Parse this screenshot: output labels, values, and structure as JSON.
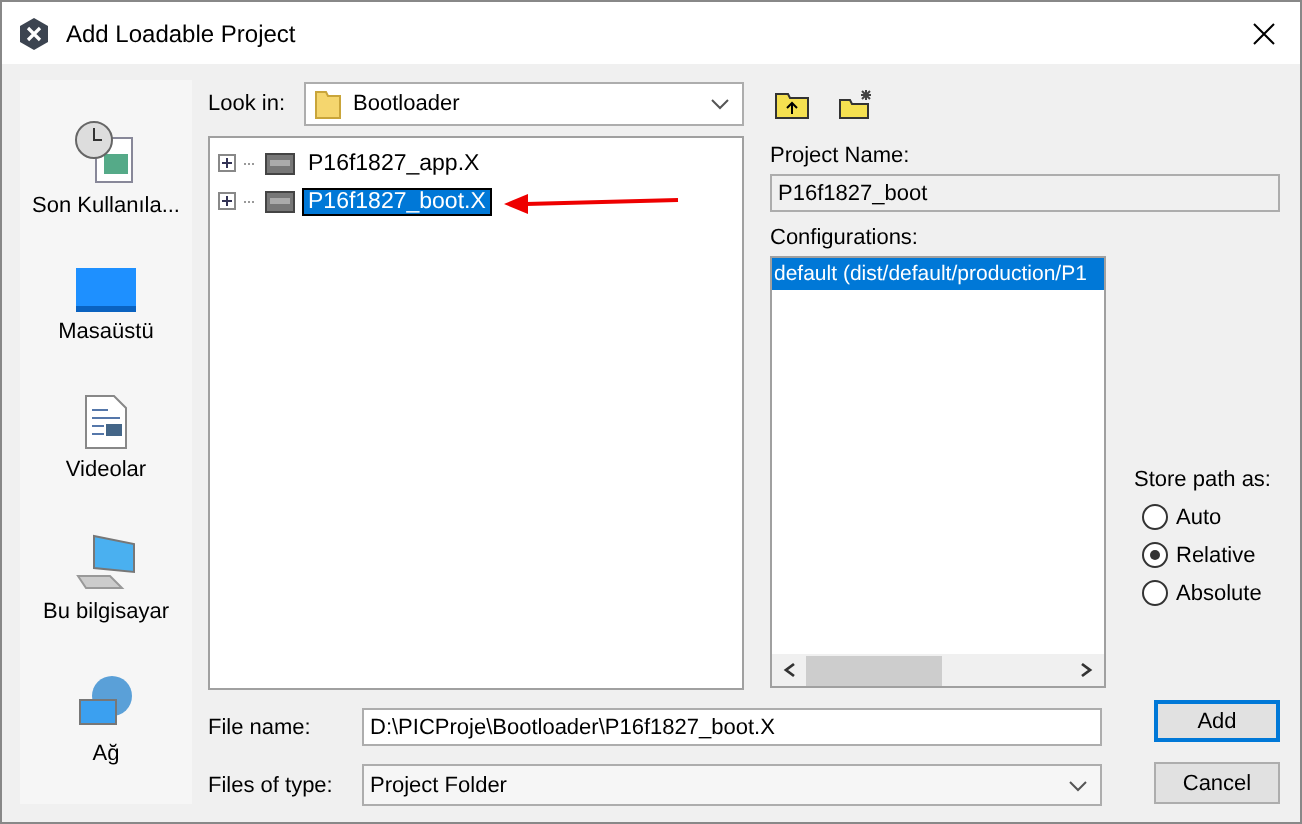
{
  "window": {
    "title": "Add Loadable Project"
  },
  "places": [
    {
      "label": "Son Kullanıla...",
      "kind": "recent"
    },
    {
      "label": "Masaüstü",
      "kind": "desktop"
    },
    {
      "label": "Videolar",
      "kind": "document"
    },
    {
      "label": "Bu bilgisayar",
      "kind": "computer"
    },
    {
      "label": "Ağ",
      "kind": "network"
    }
  ],
  "look_in": {
    "label": "Look in:",
    "value": "Bootloader"
  },
  "tree": [
    {
      "label": "P16f1827_app.X",
      "selected": false
    },
    {
      "label": "P16f1827_boot.X",
      "selected": true
    }
  ],
  "project_name": {
    "label": "Project Name:",
    "value": "P16f1827_boot"
  },
  "configurations": {
    "label": "Configurations:",
    "items": [
      {
        "label": "default (dist/default/production/P1",
        "selected": true
      }
    ]
  },
  "store_path": {
    "label": "Store path as:",
    "options": [
      {
        "label": "Auto",
        "selected": false
      },
      {
        "label": "Relative",
        "selected": true
      },
      {
        "label": "Absolute",
        "selected": false
      }
    ]
  },
  "file_name": {
    "label": "File name:",
    "value": "D:\\PICProje\\Bootloader\\P16f1827_boot.X"
  },
  "file_type": {
    "label": "Files of type:",
    "value": "Project Folder"
  },
  "buttons": [
    {
      "label": "Add",
      "default": true
    },
    {
      "label": "Cancel",
      "default": false
    }
  ]
}
